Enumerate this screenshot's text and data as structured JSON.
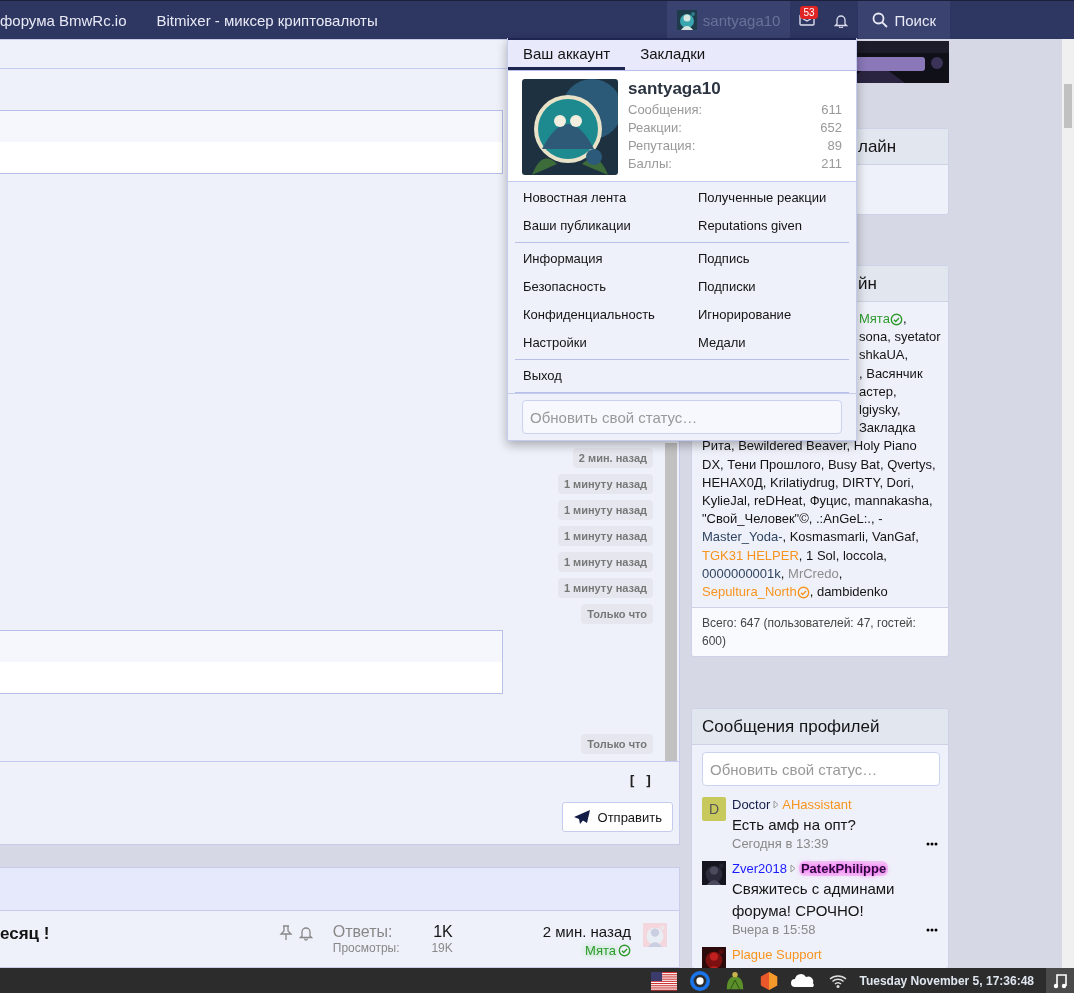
{
  "nav": {
    "links": [
      "форума BmwRc.io",
      "Bitmixer - миксер криптовалюты"
    ],
    "user": {
      "name": "santyaga10",
      "selected": true
    },
    "inbox_badge": "53",
    "search": "Поиск"
  },
  "chat": {
    "timestamps": [
      "2 мин. назад",
      "1 минуту назад",
      "1 минуту назад",
      "1 минуту назад",
      "1 минуту назад",
      "1 минуту назад",
      "Только что"
    ],
    "timestamps_after": [
      "Только что"
    ],
    "toggle": "[ ]",
    "send": "Отправить"
  },
  "threads": {
    "rows": [
      {
        "title": "есяц !",
        "replies_label": "Ответы:",
        "replies": "1K",
        "views_label": "Просмотры:",
        "views": "19K",
        "last_time": "2 мин. назад",
        "last_user": {
          "name": "Мята",
          "color": "#2e9a2e",
          "verified": true
        }
      }
    ]
  },
  "account_menu": {
    "tabs": [
      {
        "label": "Ваш аккаунт",
        "selected": true
      },
      {
        "label": "Закладки",
        "selected": false
      }
    ],
    "username": "santyaga10",
    "stats": [
      {
        "label": "Сообщения:",
        "value": "611"
      },
      {
        "label": "Реакции:",
        "value": "652"
      },
      {
        "label": "Репутация:",
        "value": "89"
      },
      {
        "label": "Баллы:",
        "value": "211"
      }
    ],
    "sections": [
      [
        "Новостная лента",
        "Полученные реакции",
        "Ваши публикации",
        "Reputations given"
      ],
      [
        "Информация",
        "Подпись",
        "Безопасность",
        "Подписки",
        "Конфиденциальность",
        "Игнорирование",
        "Настройки",
        "Медали"
      ],
      [
        "Выход"
      ]
    ],
    "status_placeholder": "Обновить свой статус…"
  },
  "sidebar": {
    "first_widget_title": "лайн",
    "online": {
      "title": "йн",
      "covered_lines": [
        [
          {
            "text": "Мята",
            "color": "#2e9a2e",
            "verified": true
          },
          {
            "text": ","
          }
        ],
        [
          {
            "text": "sona, syetator"
          }
        ],
        [
          {
            "text": "shkaUA,"
          }
        ],
        [
          {
            "text": ", Васянчик"
          }
        ],
        [
          {
            "text": "астер,"
          }
        ],
        [
          {
            "text": "lgiysky,"
          }
        ],
        [
          {
            "text": "Закладка"
          }
        ]
      ],
      "lines": [
        [
          {
            "text": "Рита, Bewildered Beaver, Holy Piano"
          }
        ],
        [
          {
            "text": "DX, Тени Прошлого, Busy Bat, Qvertys,"
          }
        ],
        [
          {
            "text": "НЕНАХ0Д, Krilatiydrug, DIRTY, Dori,"
          }
        ],
        [
          {
            "text": "KylieJal, reDHeat, Фуцис, mannakasha,"
          }
        ],
        [
          {
            "text": "\"Свой_Человек\"©, .:AnGeL:., -"
          }
        ],
        [
          {
            "text": "Master_Yoda-",
            "color": "#2f4460",
            "verified": false
          },
          {
            "text": ", Kosmasmarli, VanGaf,"
          }
        ],
        [
          {
            "text": "TGK31 HELPER",
            "color": "#f7941d",
            "verified": false
          },
          {
            "text": ", 1 Sol, loccola,"
          }
        ],
        [
          {
            "text": "0000000001k",
            "color": "#2f4460",
            "verified": false
          },
          {
            "text": ", "
          },
          {
            "text": "MrCredo",
            "color": "#8c8c8c",
            "verified": false
          },
          {
            "text": ","
          }
        ],
        [
          {
            "text": "Sepultura_North",
            "color": "#f7941d",
            "verified": true
          },
          {
            "text": ", dambidenko"
          }
        ]
      ],
      "total": "Всего: 647 (пользователей: 47, гостей: 600)"
    },
    "profile_posts": {
      "title": "Сообщения профилей",
      "placeholder": "Обновить свой статус…",
      "posts": [
        {
          "kind": "letter",
          "letter": "D",
          "author": {
            "name": "Doctor",
            "color": "#141d47"
          },
          "recipient": {
            "name": "AHassistant",
            "color": "#f7941d",
            "highlighted": false
          },
          "text": "Есть амф на опт?",
          "time": "Сегодня в 13:39"
        },
        {
          "kind": "picture",
          "author": {
            "name": "Zver2018",
            "color": "#1a1aff"
          },
          "recipient": {
            "name": "PatekPhilippe",
            "color": "#2a0a3a",
            "highlighted": true
          },
          "text": "Свяжитесь с админами форума! СРОЧНО!",
          "time": "Вчера в 15:58"
        },
        {
          "kind": "picture",
          "author": {
            "name": "Plague Support",
            "color": "#f7941d"
          }
        }
      ]
    }
  },
  "taskbar": {
    "clock": "Tuesday November 5, 17:36:48"
  }
}
